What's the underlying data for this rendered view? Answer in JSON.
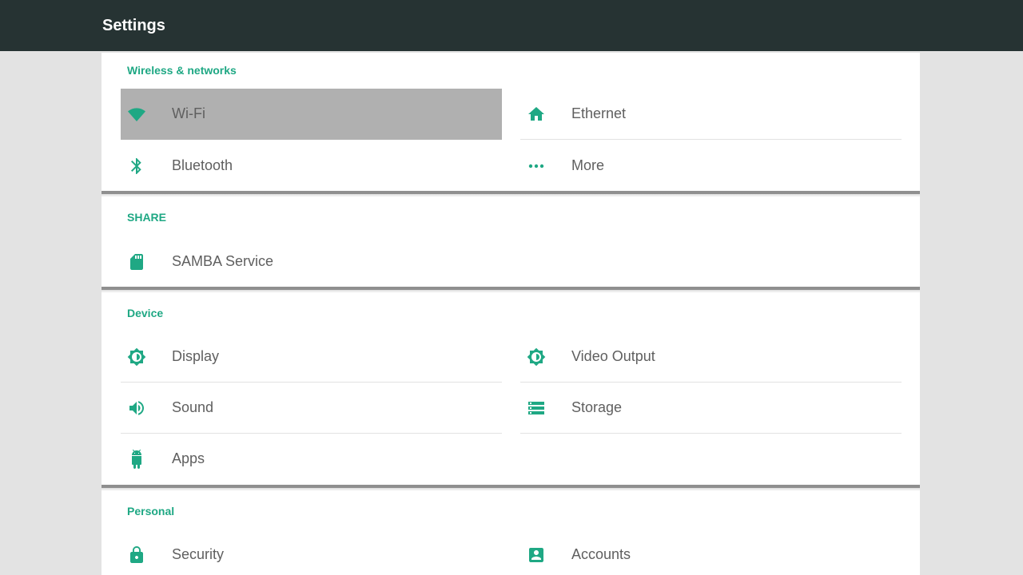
{
  "app_bar": {
    "title": "Settings"
  },
  "accent_color": "#1fa884",
  "header_color": "#263333",
  "sections": {
    "wireless": {
      "title": "Wireless & networks",
      "items": [
        {
          "label": "Wi-Fi",
          "icon": "wifi-icon",
          "focused": true
        },
        {
          "label": "Ethernet",
          "icon": "home-icon"
        },
        {
          "label": "Bluetooth",
          "icon": "bluetooth-icon"
        },
        {
          "label": "More",
          "icon": "more-icon"
        }
      ]
    },
    "share": {
      "title": "SHARE",
      "items": [
        {
          "label": "SAMBA Service",
          "icon": "sd-card-icon"
        }
      ]
    },
    "device": {
      "title": "Device",
      "items": [
        {
          "label": "Display",
          "icon": "brightness-icon"
        },
        {
          "label": "Video Output",
          "icon": "brightness-icon"
        },
        {
          "label": "Sound",
          "icon": "volume-icon"
        },
        {
          "label": "Storage",
          "icon": "storage-icon"
        },
        {
          "label": "Apps",
          "icon": "android-icon"
        }
      ]
    },
    "personal": {
      "title": "Personal",
      "items": [
        {
          "label": "Security",
          "icon": "lock-icon"
        },
        {
          "label": "Accounts",
          "icon": "account-box-icon"
        }
      ]
    }
  }
}
